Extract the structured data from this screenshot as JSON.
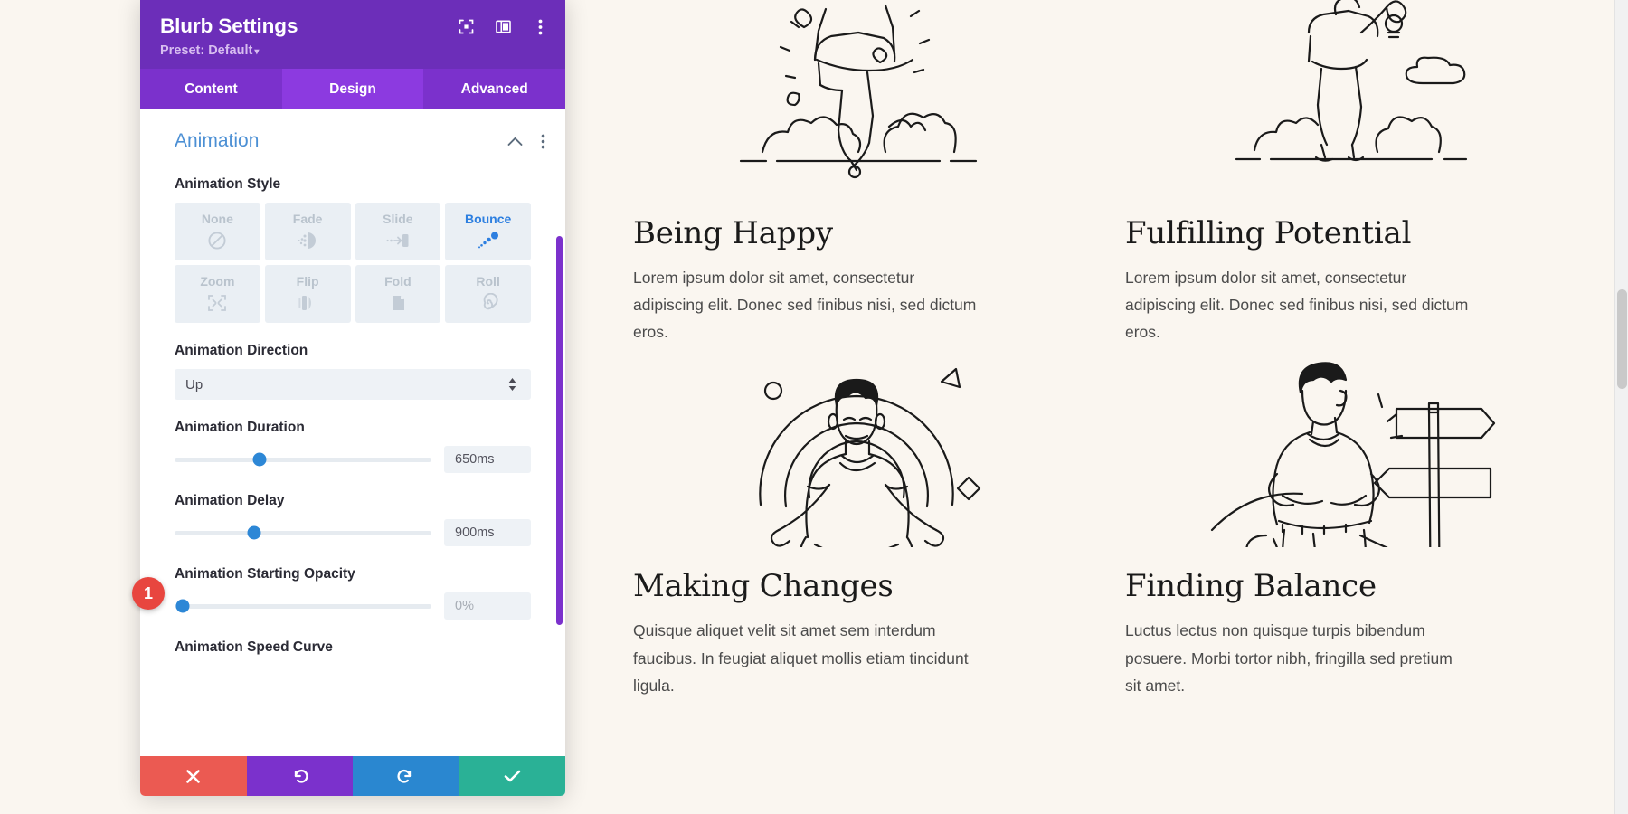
{
  "modal": {
    "title": "Blurb Settings",
    "preset_label": "Preset: Default",
    "preset_caret": "▾",
    "header_icons": [
      {
        "name": "fullscreen-icon",
        "label": "fullscreen"
      },
      {
        "name": "layout-columns-icon",
        "label": "layout"
      },
      {
        "name": "more-vertical-icon",
        "label": "more options"
      }
    ],
    "tabs": [
      {
        "label": "Content",
        "active": false
      },
      {
        "label": "Design",
        "active": true
      },
      {
        "label": "Advanced",
        "active": false
      }
    ],
    "section": {
      "title": "Animation",
      "collapse_icon": "chevron-up-icon",
      "more_icon": "more-vertical-icon"
    },
    "fields": {
      "animation_style": {
        "label": "Animation Style",
        "options": [
          {
            "label": "None",
            "icon": "no-entry-icon",
            "active": false
          },
          {
            "label": "Fade",
            "icon": "fade-icon",
            "active": false
          },
          {
            "label": "Slide",
            "icon": "slide-icon",
            "active": false
          },
          {
            "label": "Bounce",
            "icon": "bounce-icon",
            "active": true
          },
          {
            "label": "Zoom",
            "icon": "zoom-icon",
            "active": false
          },
          {
            "label": "Flip",
            "icon": "flip-icon",
            "active": false
          },
          {
            "label": "Fold",
            "icon": "fold-icon",
            "active": false
          },
          {
            "label": "Roll",
            "icon": "roll-icon",
            "active": false
          }
        ]
      },
      "animation_direction": {
        "label": "Animation Direction",
        "value": "Up"
      },
      "animation_duration": {
        "label": "Animation Duration",
        "value": "650ms",
        "knob_percent": 33
      },
      "animation_delay": {
        "label": "Animation Delay",
        "value": "900ms",
        "knob_percent": 31
      },
      "animation_starting_opacity": {
        "label": "Animation Starting Opacity",
        "value": "0%",
        "knob_percent": 3
      },
      "animation_speed_curve": {
        "label": "Animation Speed Curve"
      }
    },
    "footer": [
      {
        "name": "cancel-button",
        "icon": "close-icon",
        "class": "foot-cancel"
      },
      {
        "name": "undo-button",
        "icon": "undo-icon",
        "class": "foot-undo"
      },
      {
        "name": "redo-button",
        "icon": "redo-icon",
        "class": "foot-redo"
      },
      {
        "name": "save-button",
        "icon": "check-icon",
        "class": "foot-save"
      }
    ]
  },
  "step_badge": "1",
  "colors": {
    "header_purple": "#6c2eb9",
    "tab_purple": "#7b31cc",
    "tab_active_purple": "#8c3ae0",
    "section_blue": "#4b8fd4",
    "slider_blue": "#2d87d6",
    "accent_blue": "#2d7fe0",
    "cancel_red": "#eb5a52",
    "save_green": "#2ab196",
    "badge_red": "#e8463f",
    "page_bg": "#faf6f0"
  },
  "blurbs": [
    {
      "illustration": "person-jumping-joy-illustration",
      "title": "Being Happy",
      "body": "Lorem ipsum dolor sit amet, consectetur adipiscing elit. Donec sed finibus nisi, sed dictum eros."
    },
    {
      "illustration": "person-holding-lightbulb-illustration",
      "title": "Fulfilling Potential",
      "body": "Lorem ipsum dolor sit amet, consectetur adipiscing elit. Donec sed finibus nisi, sed dictum eros."
    },
    {
      "illustration": "person-meditating-lotus-illustration",
      "title": "Making Changes",
      "body": "Quisque aliquet velit sit amet sem interdum faucibus. In feugiat aliquet mollis etiam tincidunt ligula."
    },
    {
      "illustration": "person-at-signpost-illustration",
      "title": "Finding Balance",
      "body": "Luctus lectus non quisque turpis bibendum posuere. Morbi tortor nibh, fringilla sed pretium sit amet."
    }
  ]
}
